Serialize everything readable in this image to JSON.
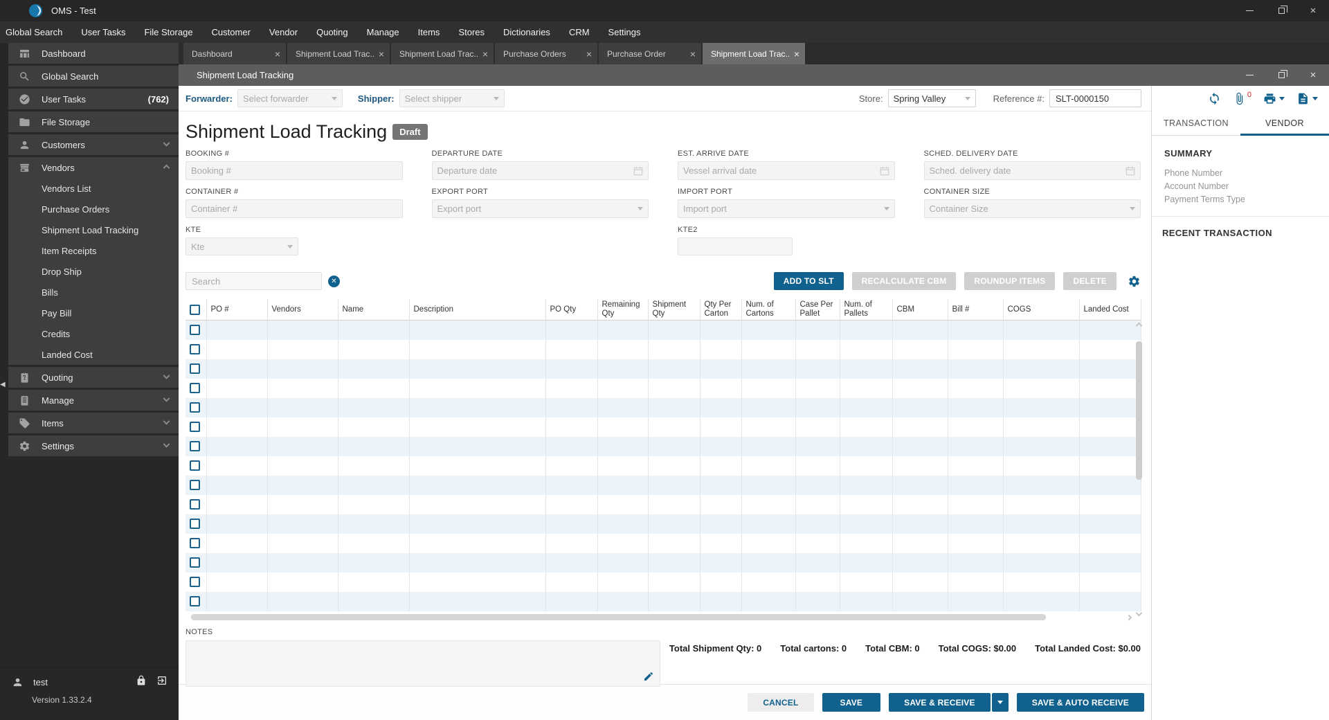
{
  "window": {
    "title": "OMS - Test"
  },
  "menubar": {
    "items": [
      "Global Search",
      "User Tasks",
      "File Storage",
      "Customer",
      "Vendor",
      "Quoting",
      "Manage",
      "Items",
      "Stores",
      "Dictionaries",
      "CRM",
      "Settings"
    ]
  },
  "sidebar": {
    "dashboard": "Dashboard",
    "global_search": "Global Search",
    "user_tasks": "User Tasks",
    "user_tasks_badge": "(762)",
    "file_storage": "File Storage",
    "customers": "Customers",
    "vendors": "Vendors",
    "vendors_sub": [
      "Vendors List",
      "Purchase Orders",
      "Shipment Load Tracking",
      "Item Receipts",
      "Drop Ship",
      "Bills",
      "Pay Bill",
      "Credits",
      "Landed Cost"
    ],
    "quoting": "Quoting",
    "manage": "Manage",
    "items": "Items",
    "settings": "Settings",
    "user": "test",
    "version": "Version 1.33.2.4"
  },
  "tabs": [
    {
      "label": "Dashboard"
    },
    {
      "label": "Shipment Load Trac..."
    },
    {
      "label": "Shipment Load Trac..."
    },
    {
      "label": "Purchase Orders"
    },
    {
      "label": "Purchase Order"
    },
    {
      "label": "Shipment Load Trac..."
    }
  ],
  "doc": {
    "window_title": "Shipment Load Tracking",
    "toolbar": {
      "forwarder_label": "Forwarder:",
      "forwarder_placeholder": "Select forwarder",
      "shipper_label": "Shipper:",
      "shipper_placeholder": "Select shipper",
      "store_label": "Store:",
      "store_value": "Spring Valley",
      "reference_label": "Reference #:",
      "reference_value": "SLT-0000150"
    },
    "title": "Shipment Load Tracking",
    "status_badge": "Draft",
    "fields": {
      "booking_label": "BOOKING #",
      "booking_placeholder": "Booking #",
      "departure_label": "DEPARTURE DATE",
      "departure_placeholder": "Departure date",
      "est_arrive_label": "EST. ARRIVE DATE",
      "est_arrive_placeholder": "Vessel arrival date",
      "sched_delivery_label": "SCHED. DELIVERY DATE",
      "sched_delivery_placeholder": "Sched. delivery date",
      "container_label": "CONTAINER #",
      "container_placeholder": "Container #",
      "export_port_label": "EXPORT PORT",
      "export_port_placeholder": "Export port",
      "import_port_label": "IMPORT PORT",
      "import_port_placeholder": "Import port",
      "container_size_label": "CONTAINER SIZE",
      "container_size_placeholder": "Container Size",
      "kte_label": "KTE",
      "kte_placeholder": "Kte",
      "kte2_label": "KTE2"
    },
    "search_placeholder": "Search",
    "actions": {
      "add_to_slt": "ADD TO SLT",
      "recalculate_cbm": "RECALCULATE CBM",
      "roundup_items": "ROUNDUP ITEMS",
      "delete": "DELETE"
    },
    "table": {
      "columns": [
        "PO #",
        "Vendors",
        "Name",
        "Description",
        "PO Qty",
        "Remaining Qty",
        "Shipment Qty",
        "Qty Per Carton",
        "Num. of Cartons",
        "Case Per Pallet",
        "Num. of Pallets",
        "CBM",
        "Bill #",
        "COGS",
        "Landed Cost"
      ],
      "empty_row_count": 15
    },
    "notes_label": "NOTES",
    "totals": {
      "shipment_qty": "Total Shipment Qty: 0",
      "cartons": "Total cartons: 0",
      "cbm": "Total CBM: 0",
      "cogs": "Total COGS: $0.00",
      "landed_cost": "Total Landed Cost: $0.00"
    },
    "footer_buttons": {
      "cancel": "CANCEL",
      "save": "SAVE",
      "save_receive": "SAVE & RECEIVE",
      "save_auto_receive": "SAVE & AUTO RECEIVE"
    }
  },
  "right_panel": {
    "attachment_count": "0",
    "tabs": {
      "transaction": "TRANSACTION",
      "vendor": "VENDOR"
    },
    "summary_title": "SUMMARY",
    "summary_items": [
      "Phone Number",
      "Account Number",
      "Payment Terms Type"
    ],
    "recent_title": "RECENT TRANSACTION"
  },
  "colors": {
    "accent": "#11618e",
    "row_stripe": "#ecf3f9",
    "badge_gray": "#757575"
  }
}
